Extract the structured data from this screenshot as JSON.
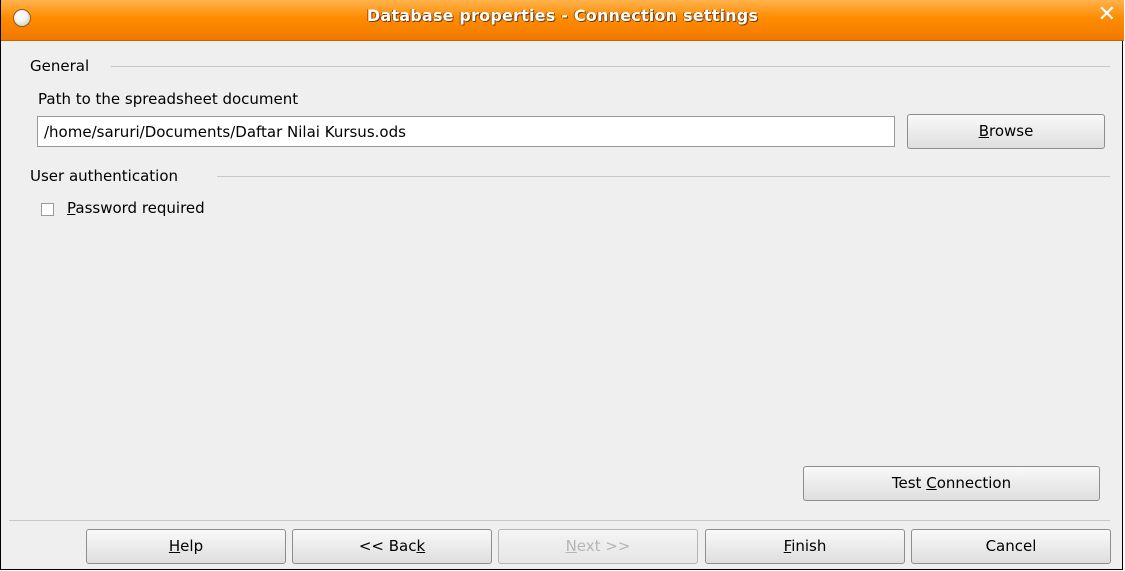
{
  "window": {
    "title": "Database properties - Connection settings",
    "close_glyph": "✕"
  },
  "general": {
    "heading": "General",
    "path_label": "Path to the spreadsheet document",
    "path_value": "/home/saruri/Documents/Daftar Nilai Kursus.ods",
    "browse": {
      "mnemonic": "B",
      "rest": "rowse"
    }
  },
  "auth": {
    "heading": "User authentication",
    "password": {
      "mnemonic": "P",
      "rest": "assword required",
      "checked": false
    }
  },
  "test_connection": {
    "before": "Test ",
    "mnemonic": "C",
    "rest": "onnection"
  },
  "footer": {
    "help": {
      "mnemonic": "H",
      "rest": "elp"
    },
    "back": {
      "before": "<< Bac",
      "mnemonic": "k"
    },
    "next": {
      "mnemonic": "N",
      "rest": "ext >>"
    },
    "finish": {
      "mnemonic": "F",
      "rest": "inish"
    },
    "cancel": "Cancel"
  },
  "colors": {
    "titlebar": "#ff8c00",
    "dialog_bg": "#efefef"
  }
}
